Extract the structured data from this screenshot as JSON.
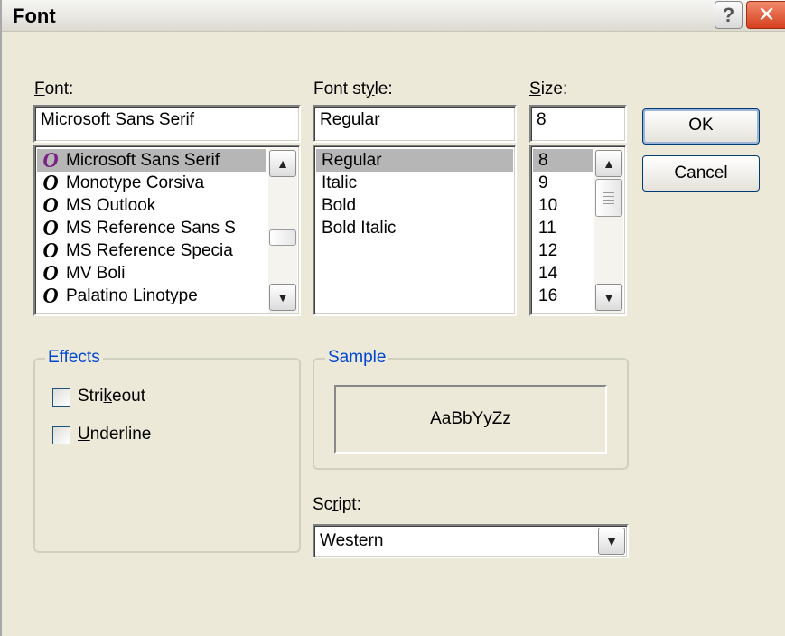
{
  "window": {
    "title": "Font",
    "help_label": "?",
    "close_label": "✕"
  },
  "font": {
    "label_mnemonic": "F",
    "label_rest": "ont:",
    "value": "Microsoft Sans Serif",
    "items": [
      {
        "icon": "O",
        "label": "Microsoft Sans Serif",
        "selected": true
      },
      {
        "icon": "O",
        "label": "Monotype Corsiva"
      },
      {
        "icon": "O",
        "label": "MS Outlook"
      },
      {
        "icon": "O",
        "label": "MS Reference Sans S"
      },
      {
        "icon": "O",
        "label": "MS Reference Specia"
      },
      {
        "icon": "O",
        "label": "MV Boli"
      },
      {
        "icon": "O",
        "label": "Palatino Linotype"
      }
    ],
    "icon_colors": {
      "selected": "#7B1F86",
      "normal": "#000000"
    }
  },
  "font_style": {
    "label_pre": "Font st",
    "label_mnemonic": "y",
    "label_post": "le:",
    "value": "Regular",
    "items": [
      "Regular",
      "Italic",
      "Bold",
      "Bold Italic"
    ]
  },
  "size": {
    "label_mnemonic": "S",
    "label_rest": "ize:",
    "value": "8",
    "items": [
      "8",
      "9",
      "10",
      "11",
      "12",
      "14",
      "16"
    ]
  },
  "buttons": {
    "ok": "OK",
    "cancel": "Cancel"
  },
  "effects": {
    "title": "Effects",
    "strikeout_pre": "Stri",
    "strikeout_mnemonic": "k",
    "strikeout_post": "eout",
    "underline_mnemonic": "U",
    "underline_post": "nderline"
  },
  "sample": {
    "title": "Sample",
    "text": "AaBbYyZz"
  },
  "script": {
    "label_pre": "Sc",
    "label_mnemonic": "r",
    "label_post": "ipt:",
    "value": "Western"
  },
  "colors": {
    "group_title": "#0046D5",
    "selection": "#B6B6B6",
    "background": "#ECE9D8"
  },
  "icons": [
    "help-icon",
    "close-icon",
    "scroll-up-icon",
    "scroll-down-icon",
    "dropdown-arrow-icon",
    "truetype-font-icon",
    "checkbox-icon"
  ]
}
